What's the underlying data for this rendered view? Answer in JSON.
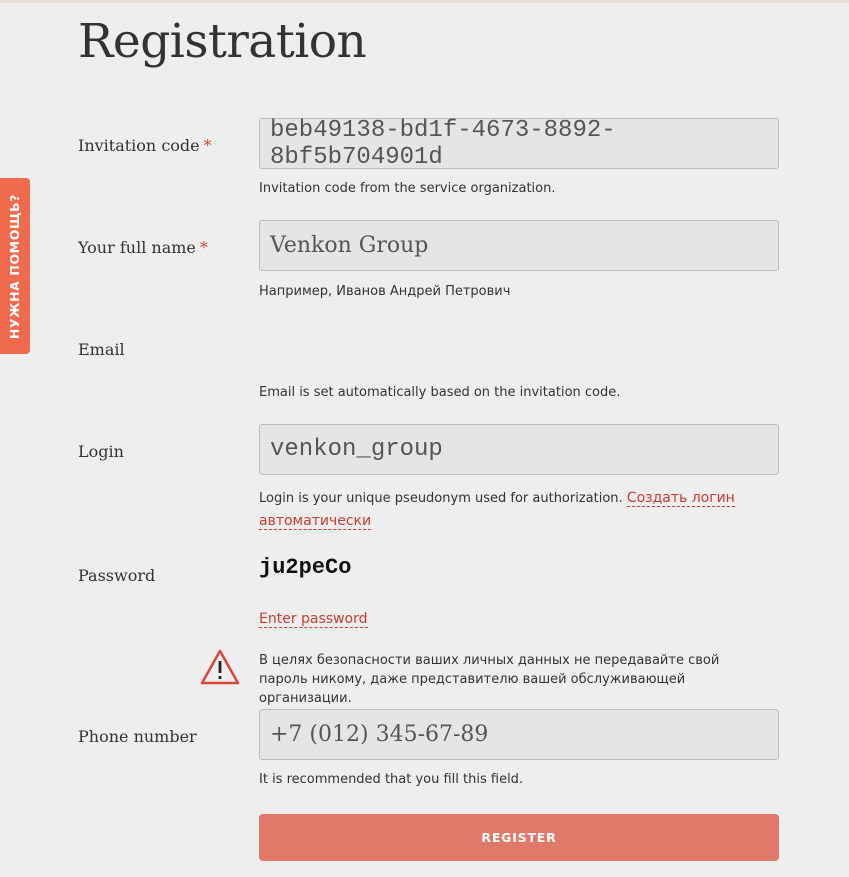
{
  "help_tab": {
    "label": "НУЖНА ПОМОЩЬ?"
  },
  "page_title": "Registration",
  "required_mark": "*",
  "invitation": {
    "label": "Invitation code",
    "value": "beb49138-bd1f-4673-8892-8bf5b704901d",
    "hint": "Invitation code from the service organization."
  },
  "full_name": {
    "label": "Your full name",
    "value": "Venkon Group",
    "hint": "Например, Иванов Андрей Петрович"
  },
  "email": {
    "label": "Email",
    "hint": "Email is set automatically based on the invitation code."
  },
  "login": {
    "label": "Login",
    "value": "venkon_group",
    "hint": "Login is your unique pseudonym used for authorization.",
    "auto_link_line1": "Создать логин",
    "auto_link_line2": "автоматически"
  },
  "password": {
    "label": "Password",
    "value": "ju2peCo",
    "enter_link": "Enter password",
    "warning_icon": "warning-triangle-icon",
    "warning": "В целях безопасности ваших личных данных не передавайте свой пароль никому, даже представителю вашей обслуживающей организации."
  },
  "phone": {
    "label": "Phone number",
    "value": "+7 (012) 345-67-89",
    "hint": "It is recommended that you fill this field."
  },
  "register_button": "REGISTER",
  "colors": {
    "accent": "#cc3b2e",
    "help_tab": "#f06a4d",
    "button": "#e0796a",
    "background": "#eeeeee"
  }
}
